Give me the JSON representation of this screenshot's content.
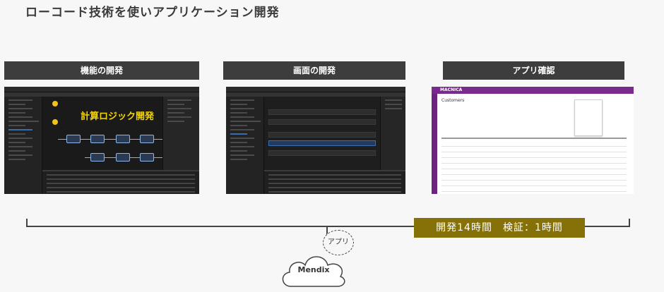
{
  "title": "ローコード技術を使いアプリケーション開発",
  "sections": [
    {
      "header": "機能の開発",
      "overlay_text": "計算ロジック開発"
    },
    {
      "header": "画面の開発"
    },
    {
      "header": "アプリ確認",
      "app_brand": "MACNICA",
      "app_page_title": "Customers"
    }
  ],
  "timeline": {
    "duration_label": "開発14時間　検証：1時間",
    "app_label": "アプリ",
    "cloud_label": "Mendix"
  },
  "colors": {
    "header_bg": "#3d3d3d",
    "duration_bg": "#857107",
    "overlay_text": "#f5d500",
    "app_purple": "#7a2a8c"
  }
}
